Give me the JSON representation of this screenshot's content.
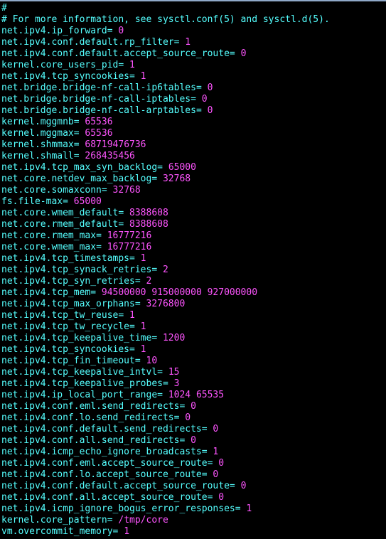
{
  "terminal": {
    "title": "sysctl.conf",
    "background_color": "#000000",
    "key_color": "#55ffff",
    "value_color": "#ff55ff",
    "comment_color": "#55ffff",
    "border_color": "#8fa8c8",
    "font_size_px": 13,
    "line_height_px": 16,
    "cols": 66,
    "rows": 47
  },
  "lines": [
    {
      "type": "comment",
      "text": "#"
    },
    {
      "type": "comment",
      "text": "# For more information, see sysctl.conf(5) and sysctl.d(5)."
    },
    {
      "type": "setting",
      "key": "net.ipv4.ip_forward",
      "eq": "= ",
      "value": "0"
    },
    {
      "type": "setting",
      "key": "net.ipv4.conf.default.rp_filter",
      "eq": "= ",
      "value": "1"
    },
    {
      "type": "setting",
      "key": "net.ipv4.conf.default.accept_source_route",
      "eq": "= ",
      "value": "0"
    },
    {
      "type": "setting",
      "key": "kernel.core_users_pid",
      "eq": "= ",
      "value": "1"
    },
    {
      "type": "setting",
      "key": "net.ipv4.tcp_syncookies",
      "eq": "= ",
      "value": "1"
    },
    {
      "type": "setting",
      "key": "net.bridge.bridge-nf-call-ip6tables",
      "eq": "= ",
      "value": "0"
    },
    {
      "type": "setting",
      "key": "net.bridge.bridge-nf-call-iptables",
      "eq": "= ",
      "value": "0"
    },
    {
      "type": "setting",
      "key": "net.bridge.bridge-nf-call-arptables",
      "eq": "= ",
      "value": "0"
    },
    {
      "type": "setting",
      "key": "kernel.mggmnb",
      "eq": "= ",
      "value": "65536"
    },
    {
      "type": "setting",
      "key": "kernel.mggmax",
      "eq": "= ",
      "value": "65536"
    },
    {
      "type": "setting",
      "key": "kernel.shmmax",
      "eq": "= ",
      "value": "68719476736"
    },
    {
      "type": "setting",
      "key": "kernel.shmall",
      "eq": "= ",
      "value": "268435456"
    },
    {
      "type": "setting",
      "key": "net.ipv4.tcp_max_syn_backlog",
      "eq": "= ",
      "value": "65000"
    },
    {
      "type": "setting",
      "key": "net.core.netdev_max_backlog",
      "eq": "= ",
      "value": "32768"
    },
    {
      "type": "setting",
      "key": "net.core.somaxconn",
      "eq": "= ",
      "value": "32768"
    },
    {
      "type": "setting",
      "key": "fs.file-max",
      "eq": "= ",
      "value": "65000"
    },
    {
      "type": "setting",
      "key": "net.core.wmem_default",
      "eq": "= ",
      "value": "8388608"
    },
    {
      "type": "setting",
      "key": "net.core.rmem_default",
      "eq": "= ",
      "value": "8388608"
    },
    {
      "type": "setting",
      "key": "net.core.rmem_max",
      "eq": "= ",
      "value": "16777216"
    },
    {
      "type": "setting",
      "key": "net.core.wmem_max",
      "eq": "= ",
      "value": "16777216"
    },
    {
      "type": "setting",
      "key": "net.ipv4.tcp_timestamps",
      "eq": "= ",
      "value": "1"
    },
    {
      "type": "setting",
      "key": "net.ipv4.tcp_synack_retries",
      "eq": "= ",
      "value": "2"
    },
    {
      "type": "setting",
      "key": "net.ipv4.tcp_syn_retries",
      "eq": "= ",
      "value": "2"
    },
    {
      "type": "setting",
      "key": "net.ipv4.tcp_mem",
      "eq": "= ",
      "value": "94500000 915000000 927000000"
    },
    {
      "type": "setting",
      "key": "net.ipv4.tcp_max_orphans",
      "eq": "= ",
      "value": "3276800"
    },
    {
      "type": "setting",
      "key": "net.ipv4.tcp_tw_reuse",
      "eq": "= ",
      "value": "1"
    },
    {
      "type": "setting",
      "key": "net.ipv4.tcp_tw_recycle",
      "eq": "= ",
      "value": "1"
    },
    {
      "type": "setting",
      "key": "net.ipv4.tcp_keepalive_time",
      "eq": "= ",
      "value": "1200"
    },
    {
      "type": "setting",
      "key": "net.ipv4.tcp_syncookies",
      "eq": "= ",
      "value": "1"
    },
    {
      "type": "setting",
      "key": "net.ipv4.tcp_fin_timeout",
      "eq": "= ",
      "value": "10"
    },
    {
      "type": "setting",
      "key": "net.ipv4.tcp_keepalive_intvl",
      "eq": "= ",
      "value": "15"
    },
    {
      "type": "setting",
      "key": "net.ipv4.tcp_keepalive_probes",
      "eq": "= ",
      "value": "3"
    },
    {
      "type": "setting",
      "key": "net.ipv4.ip_local_port_range",
      "eq": "= ",
      "value": "1024 65535"
    },
    {
      "type": "setting",
      "key": "net.ipv4.conf.eml.send_redirects",
      "eq": "= ",
      "value": "0"
    },
    {
      "type": "setting",
      "key": "net.ipv4.conf.lo.send_redirects",
      "eq": "= ",
      "value": "0"
    },
    {
      "type": "setting",
      "key": "net.ipv4.conf.default.send_redirects",
      "eq": "= ",
      "value": "0"
    },
    {
      "type": "setting",
      "key": "net.ipv4.conf.all.send_redirects",
      "eq": "= ",
      "value": "0"
    },
    {
      "type": "setting",
      "key": "net.ipv4.icmp_echo_ignore_broadcasts",
      "eq": "= ",
      "value": "1"
    },
    {
      "type": "setting",
      "key": "net.ipv4.conf.eml.accept_source_route",
      "eq": "= ",
      "value": "0"
    },
    {
      "type": "setting",
      "key": "net.ipv4.conf.lo.accept_source_route",
      "eq": "= ",
      "value": "0"
    },
    {
      "type": "setting",
      "key": "net.ipv4.conf.default.accept_source_route",
      "eq": "= ",
      "value": "0"
    },
    {
      "type": "setting",
      "key": "net.ipv4.conf.all.accept_source_route",
      "eq": "= ",
      "value": "0"
    },
    {
      "type": "setting",
      "key": "net.ipv4.icmp_ignore_bogus_error_responses",
      "eq": "= ",
      "value": "1"
    },
    {
      "type": "setting",
      "key": "kernel.core_pattern",
      "eq": "= ",
      "value": "/tmp/core"
    },
    {
      "type": "setting",
      "key": "vm.overcommit_memory",
      "eq": "= ",
      "value": "1"
    }
  ]
}
